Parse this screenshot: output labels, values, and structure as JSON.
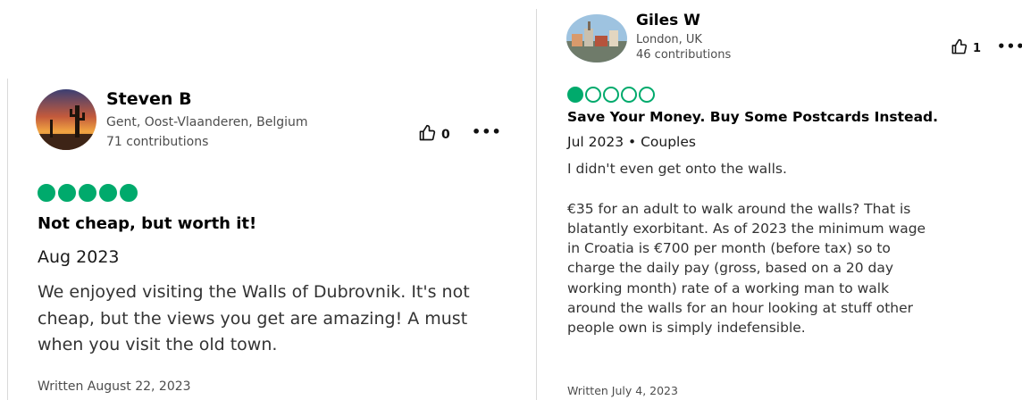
{
  "reviews": [
    {
      "author": "Steven B",
      "location": "Gent, Oost-Vlaanderen, Belgium",
      "contributions": "71 contributions",
      "helpful_count": "0",
      "rating": 5,
      "title": "Not cheap, but worth it!",
      "date": "Aug 2023",
      "body": "We enjoyed visiting the Walls of Dubrovnik. It's not\ncheap, but the views you get are amazing! A must\nwhen you visit the old town.",
      "written": "Written August 22, 2023"
    },
    {
      "author": "Giles W",
      "location": "London, UK",
      "contributions": "46 contributions",
      "helpful_count": "1",
      "rating": 1,
      "title": "Save Your Money. Buy Some Postcards Instead.",
      "date": "Jul 2023 • Couples",
      "body": "I didn't even get onto the walls.\n\n€35 for an adult to walk around the walls? That is\nblatantly exorbitant. As of 2023 the minimum wage\nin Croatia is €700 per month (before tax) so to\ncharge the daily pay (gross, based on a 20 day\nworking month) rate of a working man to walk\naround the walls for an hour looking at stuff other\npeople own is simply indefensible.",
      "written": "Written July 4, 2023"
    }
  ],
  "more_glyph": "•••",
  "colors": {
    "rating_bubble": "#00aa6c"
  }
}
